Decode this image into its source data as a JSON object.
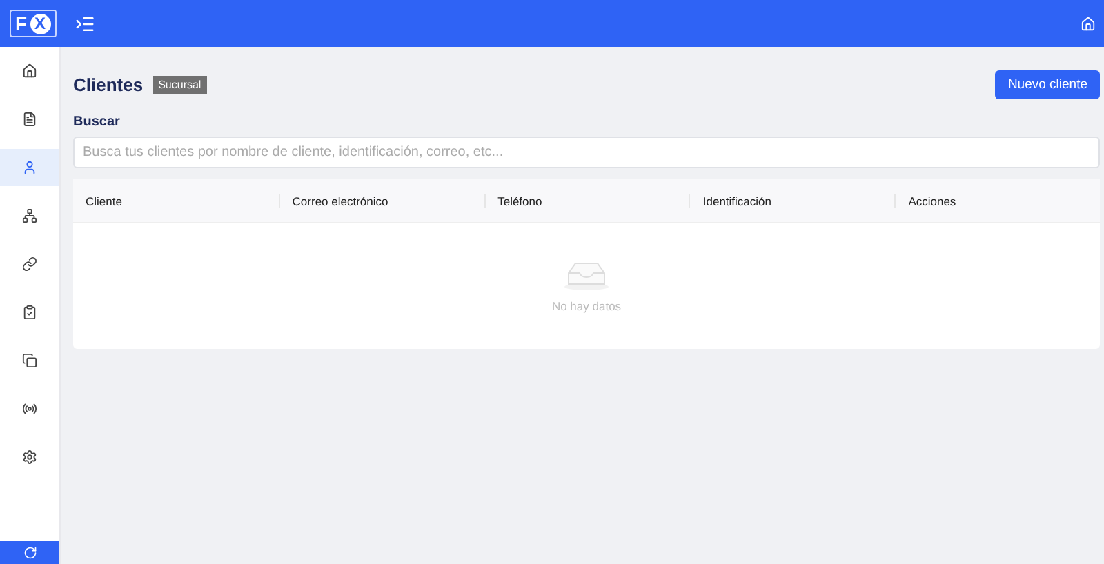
{
  "logo": {
    "letters": [
      "F",
      "X"
    ]
  },
  "sidebar": {
    "items": [
      {
        "selected": false
      },
      {
        "selected": false
      },
      {
        "selected": true
      },
      {
        "selected": false
      },
      {
        "selected": false
      },
      {
        "selected": false
      },
      {
        "selected": false
      },
      {
        "selected": false
      },
      {
        "selected": false
      }
    ]
  },
  "page": {
    "title": "Clientes",
    "badge": "Sucursal",
    "new_button": "Nuevo cliente"
  },
  "search": {
    "label": "Buscar",
    "placeholder": "Busca tus clientes por nombre de cliente, identificación, correo, etc..."
  },
  "table": {
    "columns": [
      "Cliente",
      "Correo electrónico",
      "Teléfono",
      "Identificación",
      "Acciones"
    ],
    "empty_text": "No hay datos"
  }
}
